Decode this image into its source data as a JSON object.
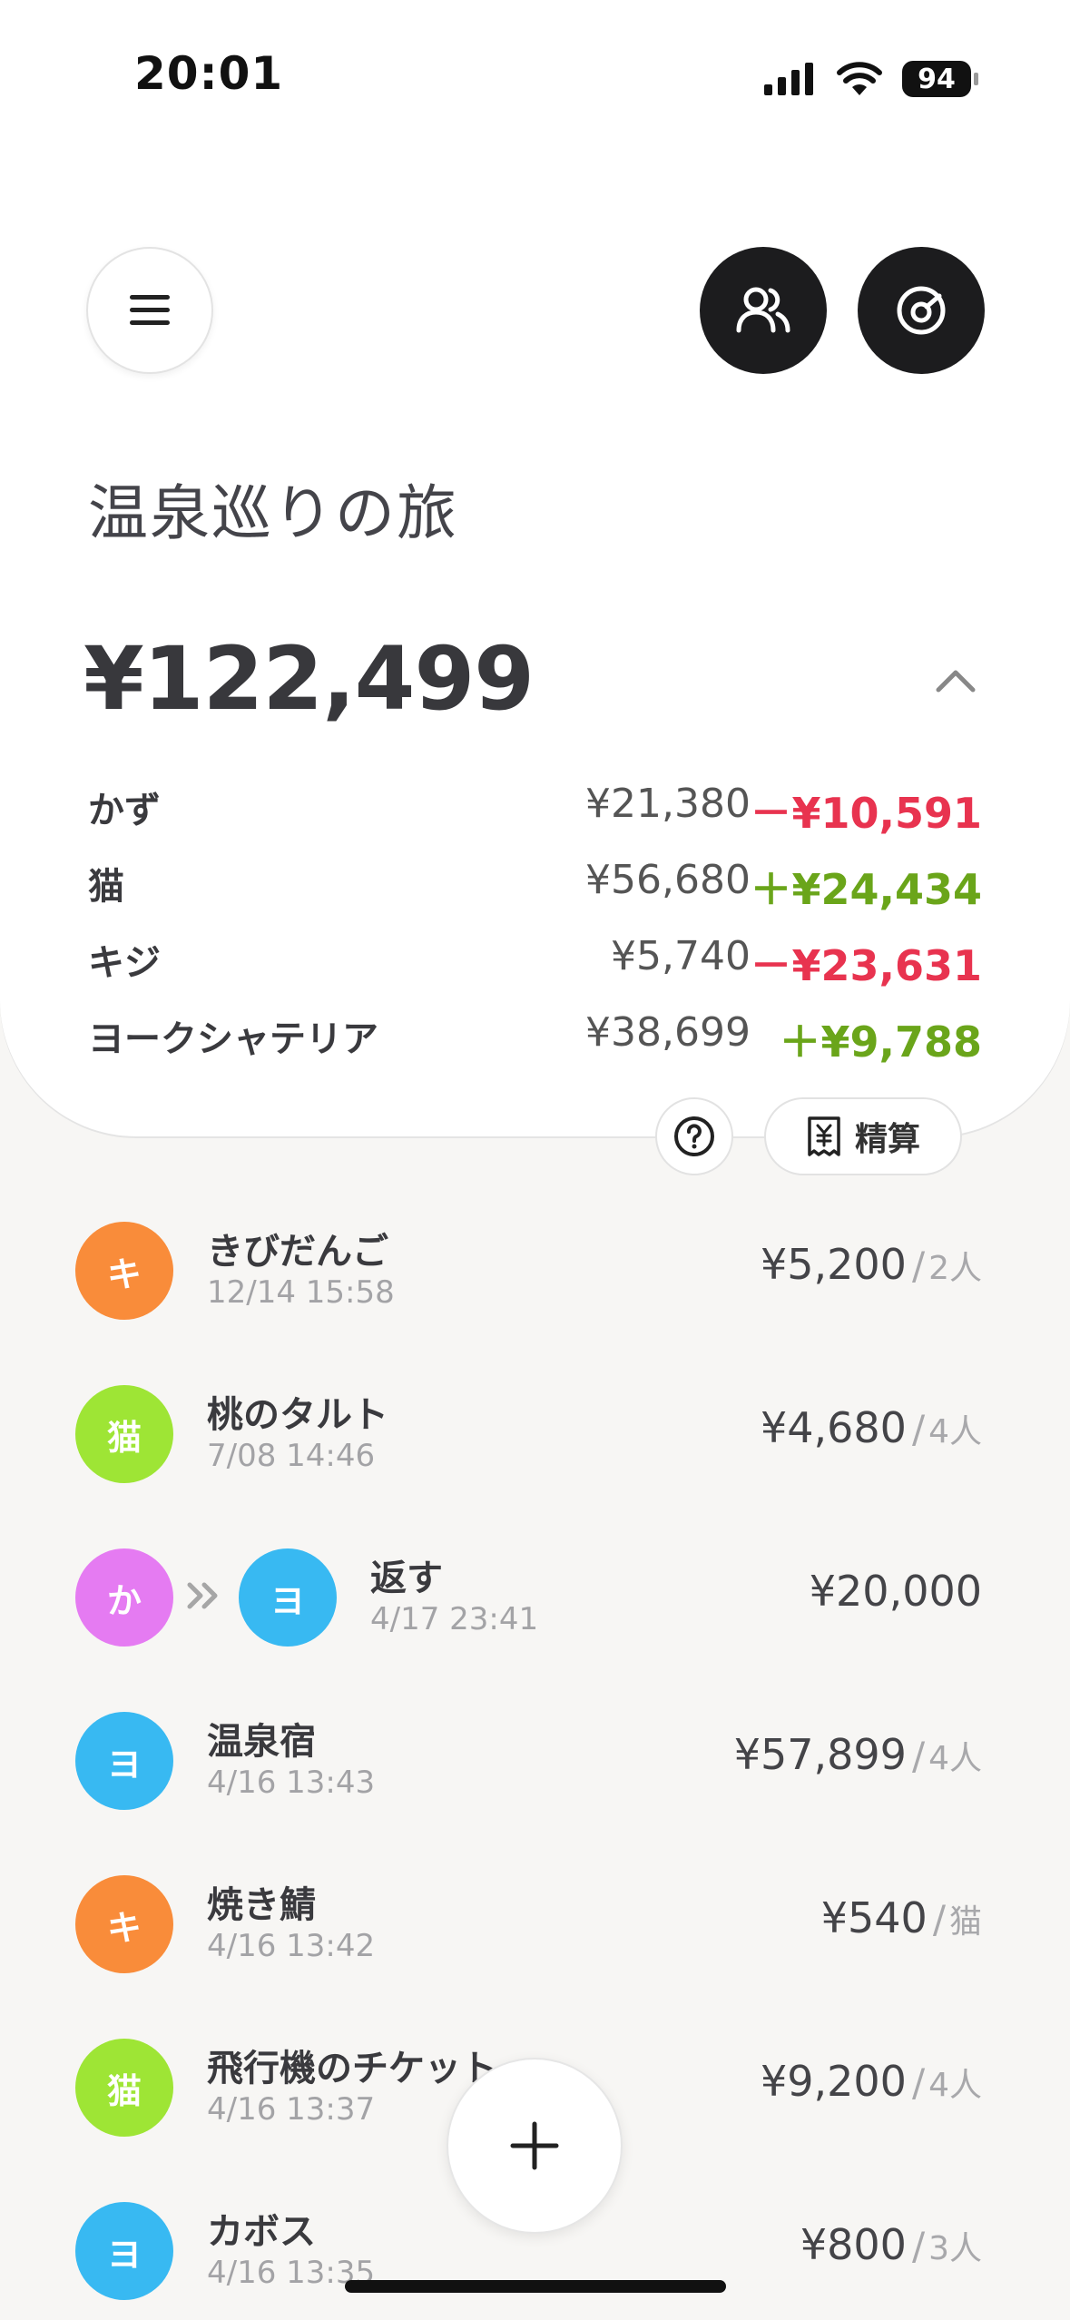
{
  "status_bar": {
    "time": "20:01",
    "battery": "94"
  },
  "trip": {
    "title": "温泉巡りの旅",
    "total": "¥122,499"
  },
  "members": [
    {
      "name": "かず",
      "paid": "¥21,380",
      "balance": "－¥10,591",
      "sign": "neg"
    },
    {
      "name": "猫",
      "paid": "¥56,680",
      "balance": "＋¥24,434",
      "sign": "pos"
    },
    {
      "name": "キジ",
      "paid": "¥5,740",
      "balance": "－¥23,631",
      "sign": "neg"
    },
    {
      "name": "ヨークシャテリア",
      "paid": "¥38,699",
      "balance": "＋¥9,788",
      "sign": "pos"
    }
  ],
  "actions": {
    "settle_label": "精算"
  },
  "transactions": [
    {
      "avatar": "キ",
      "color": "#f98c3a",
      "title": "きびだんご",
      "date": "12/14 15:58",
      "amount": "¥5,200",
      "split": "2人"
    },
    {
      "avatar": "猫",
      "color": "#9ee535",
      "title": "桃のタルト",
      "date": "7/08 14:46",
      "amount": "¥4,680",
      "split": "4人"
    },
    {
      "avatar_from": "か",
      "color_from": "#e57bf2",
      "avatar": "ヨ",
      "color": "#38b9f2",
      "title": "返す",
      "date": "4/17 23:41",
      "amount": "¥20,000"
    },
    {
      "avatar": "ヨ",
      "color": "#38b9f2",
      "title": "温泉宿",
      "date": "4/16 13:43",
      "amount": "¥57,899",
      "split": "4人"
    },
    {
      "avatar": "キ",
      "color": "#f98c3a",
      "title": "焼き鯖",
      "date": "4/16 13:42",
      "amount": "¥540",
      "split": "猫"
    },
    {
      "avatar": "猫",
      "color": "#9ee535",
      "title": "飛行機のチケット",
      "date": "4/16 13:37",
      "amount": "¥9,200",
      "split": "4人"
    },
    {
      "avatar": "ヨ",
      "color": "#38b9f2",
      "title": "カボス",
      "date": "4/16 13:35",
      "amount": "¥800",
      "split": "3人"
    }
  ],
  "icons": {
    "menu": "menu-icon",
    "members": "users-icon",
    "chart": "pie-chart-icon",
    "collapse": "chevron-up-icon",
    "help": "question-icon",
    "settle": "receipt-yen-icon",
    "add": "plus-icon"
  }
}
